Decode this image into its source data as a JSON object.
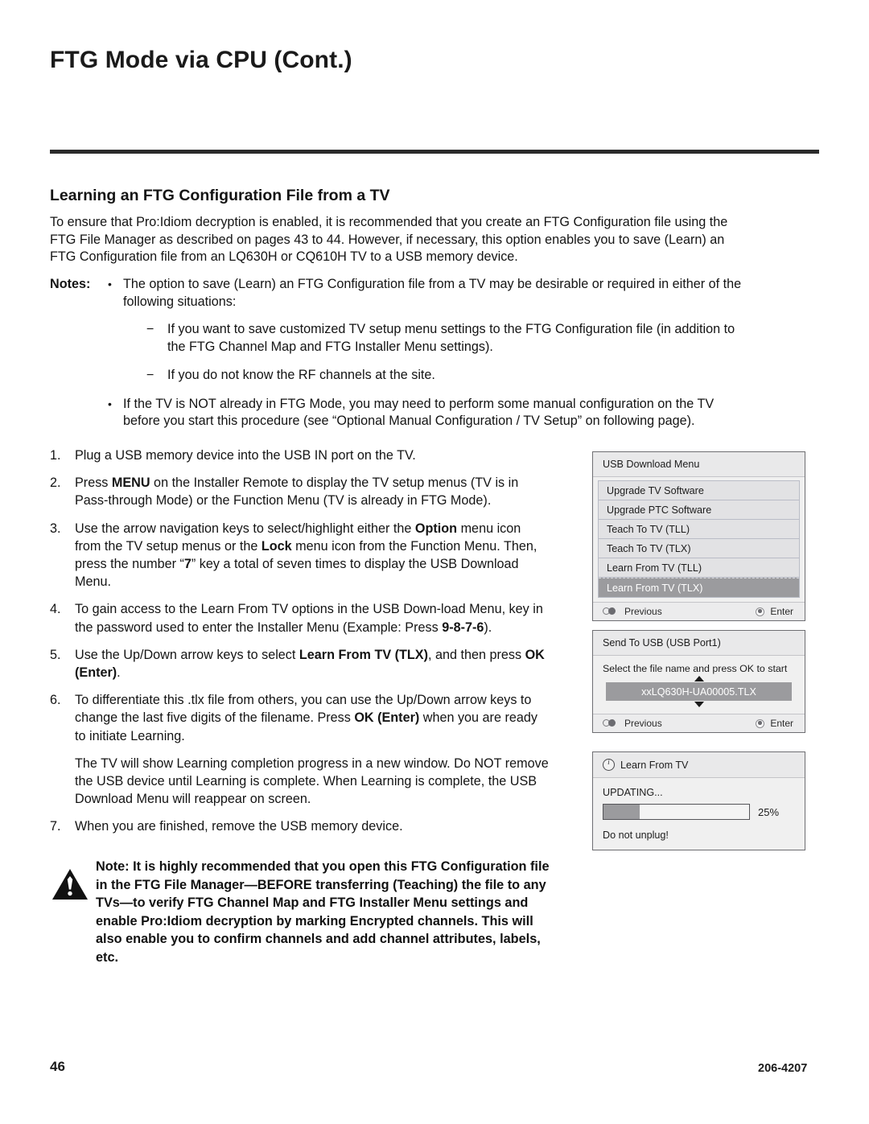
{
  "page": {
    "title": "FTG Mode via CPU (Cont.)",
    "number": "46",
    "doc_number": "206-4207"
  },
  "section": {
    "heading": "Learning an FTG Configuration File from a TV",
    "intro": "To ensure that Pro:Idiom decryption is enabled, it is recommended that you create an FTG Configuration file using the FTG File Manager as described on pages 43 to 44. However, if necessary, this option enables you to save (Learn) an FTG Configuration file from an LQ630H or CQ610H TV to a USB memory device."
  },
  "notes": {
    "label": "Notes:",
    "bullet1": "The option to save (Learn) an FTG Configuration file from a TV may be desirable or required in either of the following situations:",
    "sub1": "If you want to save customized TV setup menu settings to the FTG Configuration file (in addition to the FTG Channel Map and FTG Installer Menu settings).",
    "sub2": "If you do not know the RF channels at the site.",
    "bullet2": "If the TV is NOT already in FTG Mode, you may need to perform some manual configuration on the TV before you start this procedure (see “Optional Manual Configuration / TV Setup” on following page).",
    "bullet_char": "•",
    "dash_char": "−"
  },
  "steps": [
    {
      "num": "1.",
      "html": "Plug a USB memory device into the USB IN port on the TV."
    },
    {
      "num": "2.",
      "html": "Press <b>MENU</b> on the Installer Remote to display the TV setup menus (TV is in Pass-through Mode) or the Function Menu (TV is already in FTG Mode)."
    },
    {
      "num": "3.",
      "html": "Use the arrow navigation keys to select/highlight either the <b>Option</b> menu icon from the TV setup menus or the <b>Lock</b> menu icon from the Function Menu. Then, press the number “<b>7</b>” key a total of seven times to display the USB Download Menu."
    },
    {
      "num": "4.",
      "html": "To gain access to the Learn From TV options in the USB Down-load Menu, key in the password used to enter the Installer Menu (Example: Press <b>9-8-7-6</b>)."
    },
    {
      "num": "5.",
      "html": "Use the Up/Down arrow keys to select <b>Learn From TV (TLX)</b>, and then press <b>OK (Enter)</b>."
    },
    {
      "num": "6.",
      "html": "To differentiate this .tlx file from others, you can use the Up/Down arrow keys to change the last five digits of the filename. Press <b>OK (Enter)</b> when you are ready to initiate Learning."
    },
    {
      "num": "",
      "html": "The TV will show Learning completion progress in a new window. Do NOT remove the USB device until Learning is complete. When Learning is complete, the USB Download Menu will reappear on screen."
    },
    {
      "num": "7.",
      "html": "When you are finished, remove the USB memory device."
    }
  ],
  "warning": {
    "icon": "warning-triangle-icon",
    "text": "Note: It is highly recommended that you open this FTG Configuration file in the FTG File Manager—BEFORE transferring (Teaching) the file to any TVs—to verify FTG Channel Map and FTG Installer Menu settings and enable Pro:Idiom decryption by marking Encrypted channels. This will also enable you to confirm channels and add channel attributes, labels, etc."
  },
  "panels": {
    "usb_download_menu": {
      "header": "USB Download Menu",
      "items": [
        "Upgrade TV Software",
        "Upgrade PTC Software",
        "Teach To TV (TLL)",
        "Teach To TV (TLX)",
        "Learn From TV (TLL)",
        "Learn From TV (TLX)"
      ],
      "selected_index": 5,
      "footer_previous": "Previous",
      "footer_enter": "Enter",
      "selected_color": "#9b9b9e"
    },
    "send_to_usb": {
      "header": "Send To USB (USB Port1)",
      "instruction": "Select the file name and press OK to start",
      "filename": "xxLQ630H-UA00005.TLX",
      "footer_previous": "Previous",
      "footer_enter": "Enter"
    },
    "learn_from_tv": {
      "header": "Learn From TV",
      "status": "UPDATING...",
      "percent_label": "25%",
      "percent_value": 25,
      "warning": "Do not unplug!",
      "fill_color": "#9b9b9e"
    }
  }
}
